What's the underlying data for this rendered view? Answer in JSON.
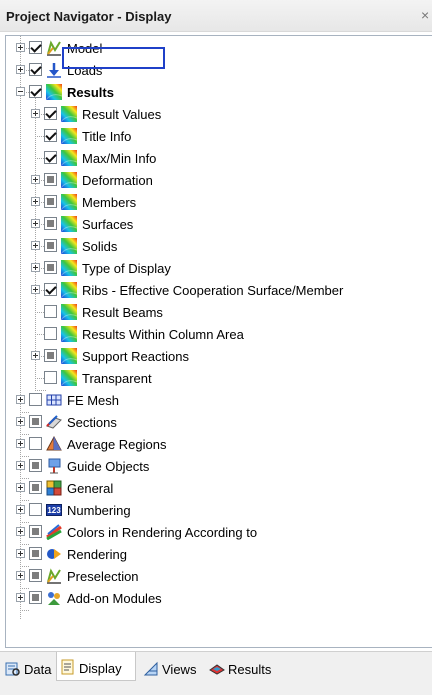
{
  "window": {
    "title": "Project Navigator - Display",
    "close_glyph": "×"
  },
  "tree": [
    {
      "label": "Model",
      "expander": "plus",
      "check": "checked",
      "icon": "model-icon",
      "level": 0
    },
    {
      "label": "Loads",
      "expander": "plus",
      "check": "checked",
      "icon": "loads-icon",
      "level": 0
    },
    {
      "label": "Results",
      "expander": "minus",
      "check": "checked",
      "icon": "results-icon",
      "level": 0,
      "bold": true,
      "selected": true
    },
    {
      "label": "Result Values",
      "expander": "plus",
      "check": "checked",
      "icon": "results-icon",
      "level": 1
    },
    {
      "label": "Title Info",
      "expander": "none",
      "check": "checked",
      "icon": "results-icon",
      "level": 1
    },
    {
      "label": "Max/Min Info",
      "expander": "none",
      "check": "checked",
      "icon": "results-icon",
      "level": 1
    },
    {
      "label": "Deformation",
      "expander": "plus",
      "check": "partial",
      "icon": "results-icon",
      "level": 1
    },
    {
      "label": "Members",
      "expander": "plus",
      "check": "partial",
      "icon": "results-icon",
      "level": 1
    },
    {
      "label": "Surfaces",
      "expander": "plus",
      "check": "partial",
      "icon": "results-icon",
      "level": 1
    },
    {
      "label": "Solids",
      "expander": "plus",
      "check": "partial",
      "icon": "results-icon",
      "level": 1
    },
    {
      "label": "Type of Display",
      "expander": "plus",
      "check": "partial",
      "icon": "results-icon",
      "level": 1
    },
    {
      "label": "Ribs - Effective Cooperation Surface/Member",
      "expander": "plus",
      "check": "checked",
      "icon": "results-icon",
      "level": 1
    },
    {
      "label": "Result Beams",
      "expander": "none",
      "check": "unchecked",
      "icon": "results-icon",
      "level": 1
    },
    {
      "label": "Results Within Column Area",
      "expander": "none",
      "check": "unchecked",
      "icon": "results-icon",
      "level": 1
    },
    {
      "label": "Support Reactions",
      "expander": "plus",
      "check": "partial",
      "icon": "results-icon",
      "level": 1
    },
    {
      "label": "Transparent",
      "expander": "none",
      "check": "unchecked",
      "icon": "results-icon",
      "level": 1
    },
    {
      "label": "FE Mesh",
      "expander": "plus",
      "check": "unchecked",
      "icon": "fe-mesh-icon",
      "level": 0
    },
    {
      "label": "Sections",
      "expander": "plus",
      "check": "partial",
      "icon": "sections-icon",
      "level": 0
    },
    {
      "label": "Average Regions",
      "expander": "plus",
      "check": "unchecked",
      "icon": "average-regions-icon",
      "level": 0
    },
    {
      "label": "Guide Objects",
      "expander": "plus",
      "check": "partial",
      "icon": "guide-objects-icon",
      "level": 0
    },
    {
      "label": "General",
      "expander": "plus",
      "check": "partial",
      "icon": "general-icon",
      "level": 0
    },
    {
      "label": "Numbering",
      "expander": "plus",
      "check": "unchecked",
      "icon": "numbering-icon",
      "level": 0
    },
    {
      "label": "Colors in Rendering According to",
      "expander": "plus",
      "check": "partial",
      "icon": "colors-icon",
      "level": 0
    },
    {
      "label": "Rendering",
      "expander": "plus",
      "check": "partial",
      "icon": "rendering-icon",
      "level": 0
    },
    {
      "label": "Preselection",
      "expander": "plus",
      "check": "partial",
      "icon": "preselection-icon",
      "level": 0
    },
    {
      "label": "Add-on Modules",
      "expander": "plus",
      "check": "partial",
      "icon": "addon-modules-icon",
      "level": 0
    }
  ],
  "numbering_icon_text": "123",
  "tabs": [
    {
      "label": "Data",
      "icon": "data-tab-icon",
      "active": false
    },
    {
      "label": "Display",
      "icon": "display-tab-icon",
      "active": true
    },
    {
      "label": "Views",
      "icon": "views-tab-icon",
      "active": false
    },
    {
      "label": "Results",
      "icon": "results-tab-icon",
      "active": false
    }
  ],
  "colors": {
    "selection_border": "#1f40c8",
    "tree_line": "#a0a0a0",
    "panel_border": "#a8b3c0"
  }
}
